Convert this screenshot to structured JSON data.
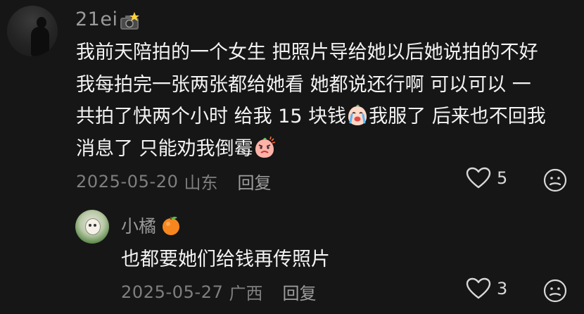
{
  "comment": {
    "username": "21ei",
    "username_icon": "camera-flash-icon",
    "lines": [
      "我前天陪拍的一个女生 把照片导给她以后她说拍的不好",
      "我每拍完一张两张都给她看 她都说还行啊 可以可以 一",
      "共拍了快两个小时 给我 15 块钱",
      "我服了 后来也不回我",
      "消息了 只能劝我倒霉"
    ],
    "emojis": [
      "crying-face-emoji",
      "angry-face-emoji"
    ],
    "date": "2025-05-20",
    "location": "山东",
    "reply_label": "回复",
    "like_count": "5"
  },
  "reply": {
    "username": "小橘",
    "username_icon": "orange-fruit-icon",
    "text": "也都要她们给钱再传照片",
    "date": "2025-05-27",
    "location": "广西",
    "reply_label": "回复",
    "like_count": "3"
  },
  "colors": {
    "background": "#161616",
    "text_primary": "#f3f3f3",
    "text_secondary": "#9a9a9a",
    "text_meta": "#7f7f7f"
  }
}
